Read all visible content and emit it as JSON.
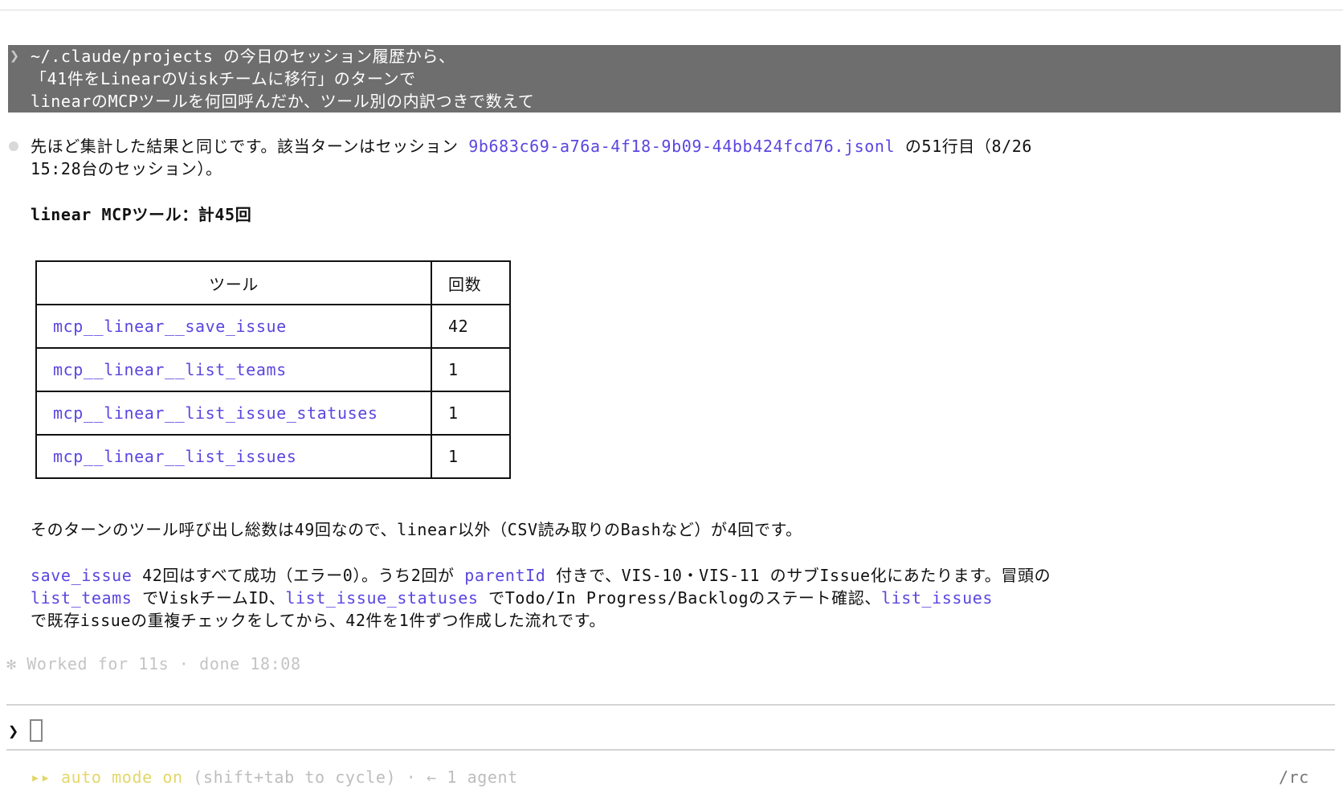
{
  "prompt": {
    "chevron": "❯",
    "lines": [
      "~/.claude/projects の今日のセッション履歴から、",
      "「41件をLinearのViskチームに移行」のターンで",
      "linearのMCPツールを何回呼んだか、ツール別の内訳つきで数えて"
    ]
  },
  "response": {
    "para1": {
      "a": "先ほど集計した結果と同じです。該当ターンはセッション ",
      "file": "9b683c69-a76a-4f18-9b09-44bb424fcd76.jsonl",
      "b": " の51行目（8/26",
      "line2": "15:28台のセッション）。"
    },
    "total_heading": "linear MCPツール：計45回",
    "table": {
      "headers": [
        "ツール",
        "回数"
      ],
      "rows": [
        {
          "tool": "mcp__linear__save_issue",
          "count": "42"
        },
        {
          "tool": "mcp__linear__list_teams",
          "count": "1"
        },
        {
          "tool": "mcp__linear__list_issue_statuses",
          "count": "1"
        },
        {
          "tool": "mcp__linear__list_issues",
          "count": "1"
        }
      ]
    },
    "para2": "そのターンのツール呼び出し総数は49回なので、linear以外（CSV読み取りのBashなど）が4回です。",
    "para3": {
      "l1_code1": "save_issue",
      "l1_a": " 42回はすべて成功（エラー0）。うち2回が ",
      "l1_code2": "parentId",
      "l1_b": " 付きで、VIS-10・VIS-11 のサブIssue化にあたります。冒頭の",
      "l2_code1": "list_teams",
      "l2_a": " でViskチームID、",
      "l2_code2": "list_issue_statuses",
      "l2_b": " でTodo/In Progress/Backlogのステート確認、",
      "l2_code3": "list_issues",
      "l3": "で既存issueの重複チェックをしてから、42件を1件ずつ作成した流れです。"
    }
  },
  "worked": "✻ Worked for 11s · done 18:08",
  "input": {
    "chevron": "❯"
  },
  "status_bar": {
    "mode_icon": "▸▸",
    "mode_label": "auto mode on",
    "hint": " (shift+tab to cycle) · ← 1 agent",
    "shortcut": "/rc"
  }
}
